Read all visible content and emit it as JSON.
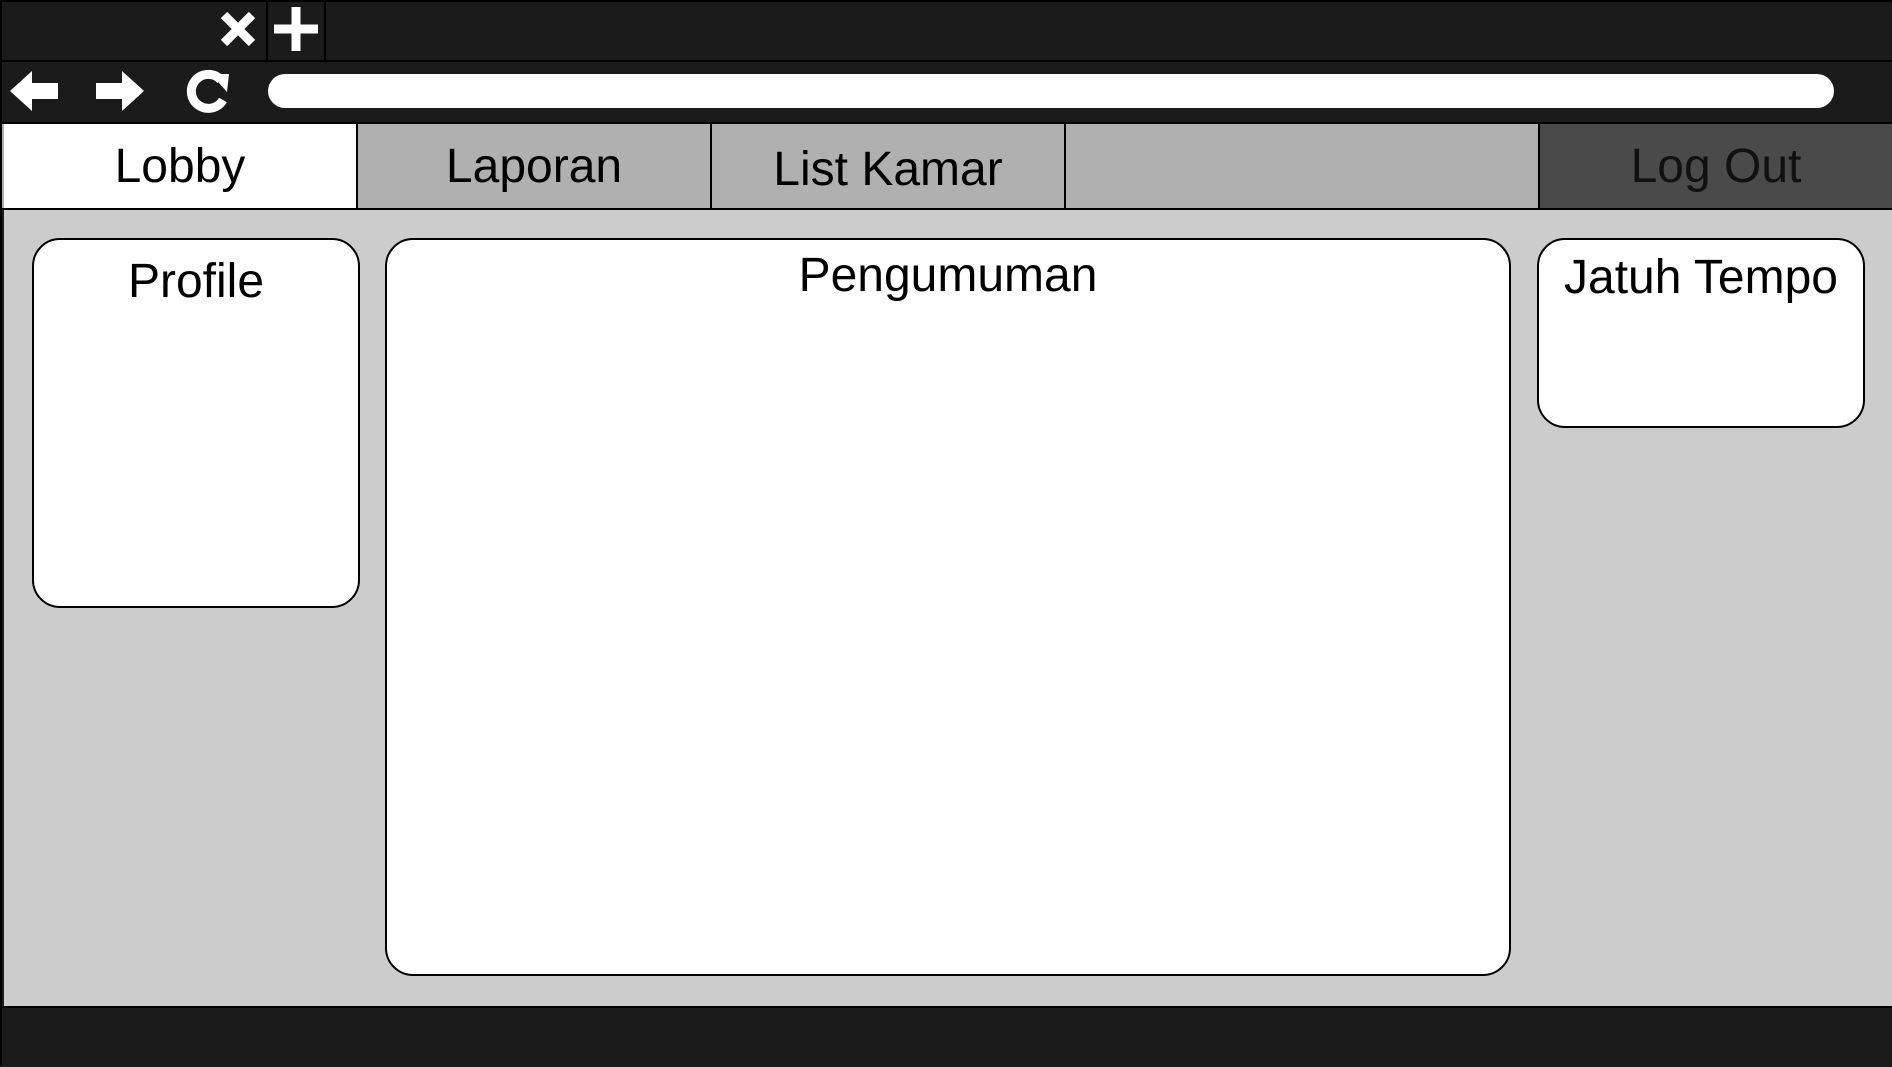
{
  "browser": {
    "tab_controls": {
      "close_icon": "close-icon",
      "add_icon": "plus-icon"
    },
    "nav": {
      "back_icon": "arrow-left-icon",
      "forward_icon": "arrow-right-icon",
      "reload_icon": "reload-icon"
    },
    "address": {
      "value": ""
    }
  },
  "tabs": [
    {
      "label": "Lobby"
    },
    {
      "label": "Laporan"
    },
    {
      "label": "List Kamar"
    }
  ],
  "logout": {
    "label": "Log Out"
  },
  "panels": {
    "profile": {
      "title": "Profile"
    },
    "pengumuman": {
      "title": "Pengumuman"
    },
    "jatuh_tempo": {
      "title": "Jatuh Tempo"
    }
  },
  "colors": {
    "chrome": "#1b1b1b",
    "active_tab": "#ffffff",
    "inactive_tab": "#b0b0b0",
    "logout_tab": "#4a4a4a",
    "content_bg": "#cccccc"
  }
}
